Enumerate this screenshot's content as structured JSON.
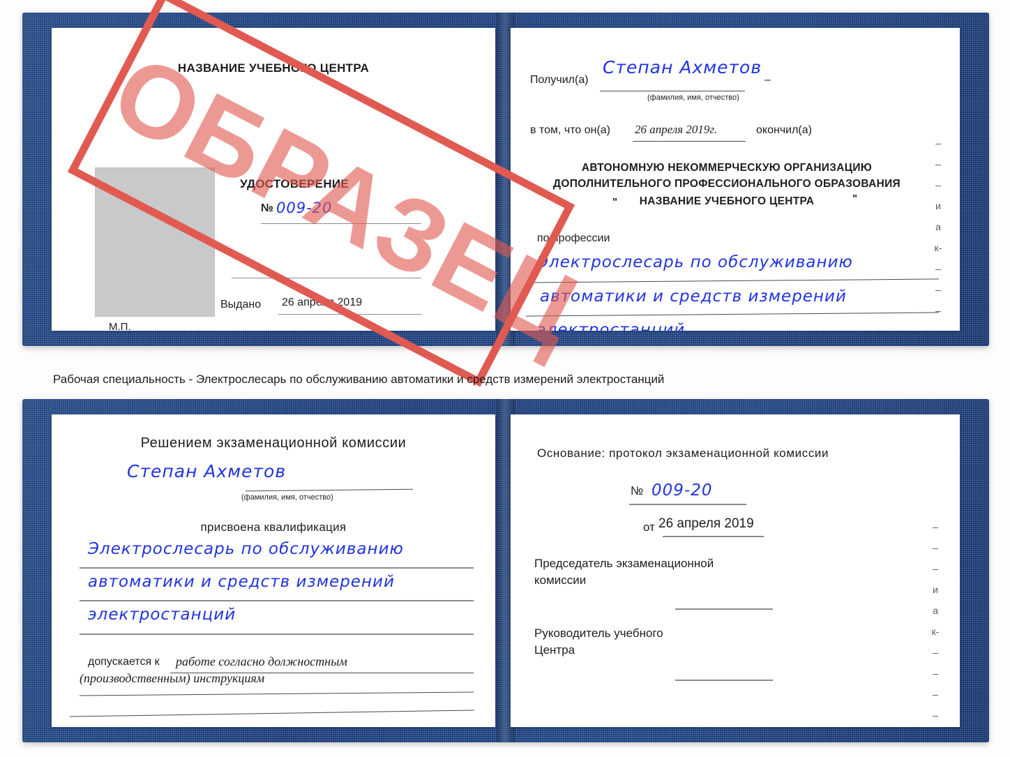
{
  "document": {
    "type": "certificate-scan",
    "colors": {
      "cover_blue": "#1e4283",
      "handwriting_blue": "#2233dd",
      "stamp_red": "#e15a52",
      "photo_placeholder_gray": "#c9c9c9",
      "rule_gray": "#8b8b8b"
    }
  },
  "stamp": {
    "label": "ОБРАЗЕЦ"
  },
  "caption": {
    "text": "Рабочая специальность - Электрослесарь по обслуживанию автоматики и средств измерений электростанций"
  },
  "certificate_top": {
    "left_page": {
      "heading": "НАЗВАНИЕ УЧЕБНОГО ЦЕНТРА",
      "title": "УДОСТОВЕРЕНИЕ",
      "number_label": "№",
      "number_value": "009-20",
      "issued_label": "Выдано",
      "issued_value": "26 апреля 2019",
      "seal_label": "М.П."
    },
    "right_page": {
      "received_label": "Получил(а)",
      "received_value": "Степан Ахметов",
      "received_hint": "(фамилия, имя, отчество)",
      "statement_label": "в том, что он(а)",
      "statement_date": "26 апреля 2019г.",
      "statement_suffix": "окончил(а)",
      "organization_line1": "АВТОНОМНУЮ НЕКОММЕРЧЕСКУЮ ОРГАНИЗАЦИЮ",
      "organization_line2": "ДОПОЛНИТЕЛЬНОГО ПРОФЕССИОНАЛЬНОГО ОБРАЗОВАНИЯ",
      "organization_quote_open": "\"",
      "organization_line3": "НАЗВАНИЕ УЧЕБНОГО ЦЕНТРА",
      "organization_quote_close": "\"",
      "profession_label": "по профессии",
      "profession_line1": "Электрослесарь по обслуживанию",
      "profession_line2": "автоматики и средств измерений",
      "profession_line3": "электростанций",
      "bleed_marks": [
        "–",
        "–",
        "–",
        "и",
        "а",
        "к-",
        "–",
        "–",
        "–",
        "–",
        "–"
      ]
    }
  },
  "certificate_bottom": {
    "left_page": {
      "heading": "Решением экзаменационной комиссии",
      "name_value": "Степан Ахметов",
      "name_hint": "(фамилия, имя, отчество)",
      "qualification_label": "присвоена квалификация",
      "qualification_line1": "Электрослесарь по обслуживанию",
      "qualification_line2": "автоматики и средств измерений",
      "qualification_line3": "электростанций",
      "allowed_label": "допускается к",
      "allowed_value_line1": "работе согласно должностным",
      "allowed_value_line2": "(производственным) инструкциям"
    },
    "right_page": {
      "basis_label": "Основание: протокол экзаменационной комиссии",
      "number_label": "№",
      "number_value": "009-20",
      "date_label": "от",
      "date_value": "26 апреля 2019",
      "chairman_line1": "Председатель экзаменационной",
      "chairman_line2": "комиссии",
      "director_line1": "Руководитель учебного",
      "director_line2": "Центра",
      "bleed_marks": [
        "–",
        "–",
        "–",
        "и",
        "а",
        "к-",
        "–",
        "–",
        "–",
        "–",
        "–"
      ]
    }
  }
}
